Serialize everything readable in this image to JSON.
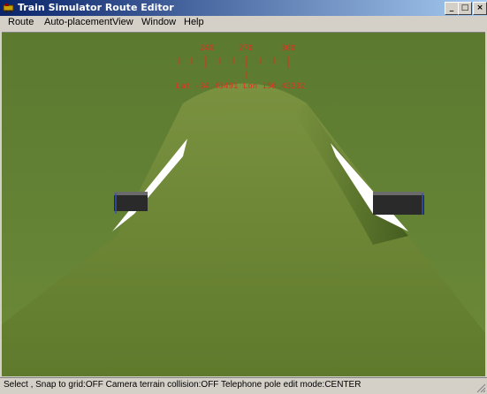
{
  "window": {
    "title": "Train Simulator Route Editor",
    "buttons": {
      "minimize": "_",
      "maximize": "□",
      "close": "×"
    }
  },
  "menu": {
    "items": [
      {
        "label": "Route"
      },
      {
        "label": "Auto-placement"
      },
      {
        "label": "View"
      },
      {
        "label": "Window"
      },
      {
        "label": "Help"
      }
    ]
  },
  "compass": {
    "headings": [
      "240",
      "270",
      "300"
    ],
    "coordinates": "Lat -34.43491 Lon 150.43332"
  },
  "status": {
    "text": "Select , Snap to grid:OFF Camera terrain collision:OFF Telephone pole edit mode:CENTER"
  },
  "colors": {
    "titlebar_start": "#0a246a",
    "titlebar_end": "#a6caf0",
    "hud": "#e03020",
    "terrain": "#5d7a2e",
    "embankment": "#6e8a33"
  },
  "icons": {
    "app": "train-icon",
    "grip": "resize-grip-icon"
  }
}
